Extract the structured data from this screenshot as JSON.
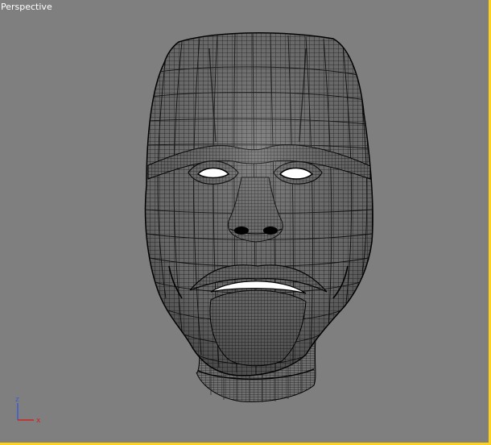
{
  "viewport": {
    "label": "Perspective",
    "background": "#7f7f7f",
    "active_border_color": "#ffd21a",
    "shading": "wireframe"
  },
  "model": {
    "type": "head mesh",
    "wire_color": "#000000",
    "surface_color": "#6e6e6e"
  },
  "axis_gizmo": {
    "z_label": "z",
    "x_label": "x",
    "z_color": "#3b5bd6",
    "x_color": "#d22020"
  }
}
